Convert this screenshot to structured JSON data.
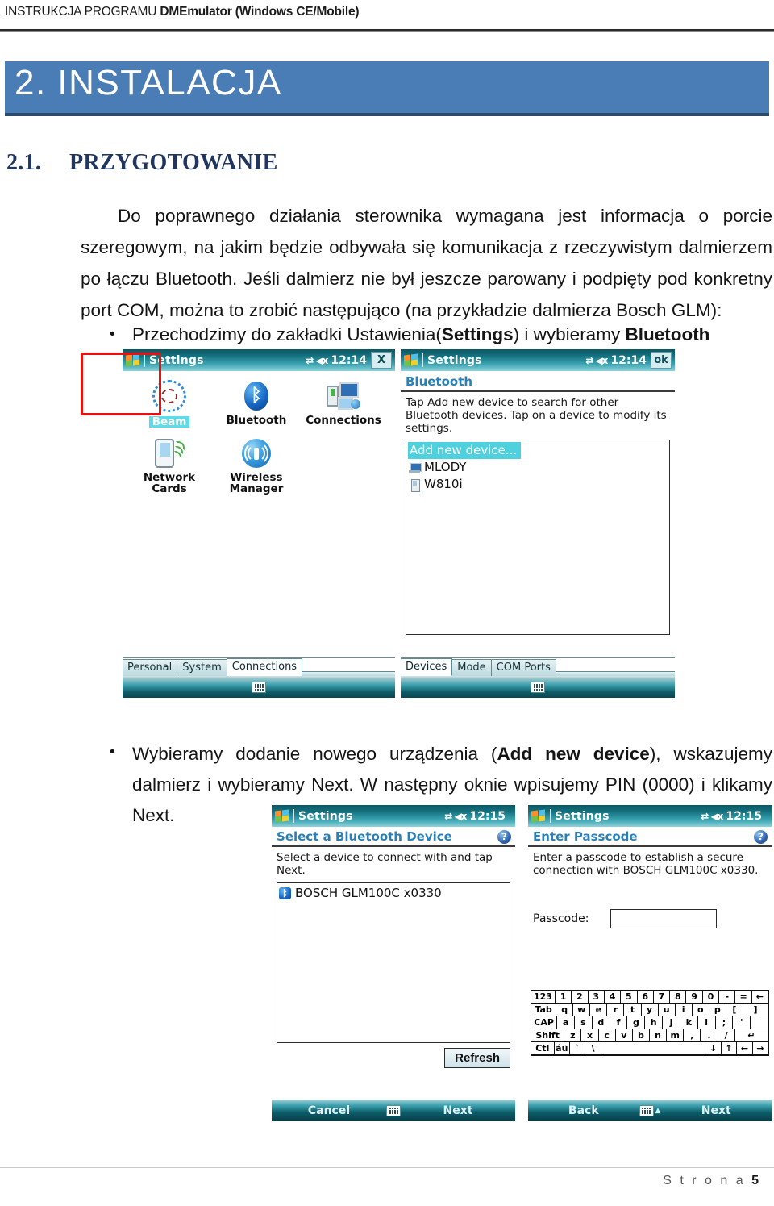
{
  "header": {
    "prefix": "INSTRUKCJA PROGRAMU",
    "title": "DMEmulator (Windows CE/Mobile)"
  },
  "section": {
    "banner_label": "2.  INSTALACJA",
    "sub_number": "2.1.",
    "sub_title": "PRZYGOTOWANIE"
  },
  "body": {
    "paragraph": "Do poprawnego działania sterownika wymagana jest informacja o porcie szeregowym, na jakim będzie odbywała się komunikacja z rzeczywistym dalmierzem po łączu Bluetooth. Jeśli dalmierz nie był jeszcze parowany i podpięty pod konkretny port COM, można to zrobić następująco (na przykładzie dalmierza Bosch GLM):",
    "bullet1_pre": "Przechodzimy do zakładki Ustawienia(",
    "bullet1_b1": "Settings",
    "bullet1_mid": ") i wybieramy ",
    "bullet1_b2": "Bluetooth",
    "bullet2_pre": "Wybieramy dodanie nowego urządzenia (",
    "bullet2_b1": "Add new device",
    "bullet2_post": "), wskazujemy dalmierz i wybieramy Next. W następny oknie wpisujemy PIN (0000) i klikamy Next.",
    "bullet_dot": "•"
  },
  "screen_settings": {
    "titlebar": {
      "title": "Settings",
      "clock": "12:14",
      "corner": "X",
      "sysicons": "⇄ ◀x"
    },
    "icons": [
      {
        "label": "Beam",
        "icon": "beam-icon"
      },
      {
        "label": "Bluetooth",
        "icon": "bluetooth-icon"
      },
      {
        "label": "Connections",
        "icon": "connections-icon"
      },
      {
        "label": "Network Cards",
        "icon": "network-cards-icon"
      },
      {
        "label": "Wireless Manager",
        "icon": "wireless-manager-icon"
      }
    ],
    "tabs": [
      {
        "label": "Personal",
        "active": false
      },
      {
        "label": "System",
        "active": false
      },
      {
        "label": "Connections",
        "active": true
      }
    ]
  },
  "screen_bluetooth": {
    "titlebar": {
      "title": "Settings",
      "clock": "12:14",
      "corner": "ok"
    },
    "page_title": "Bluetooth",
    "help_text": "Tap Add new device to search for other Bluetooth devices. Tap on a device to modify its settings.",
    "devices": [
      {
        "label": "Add new device...",
        "selected": true
      },
      {
        "label": "MLODY",
        "icon": "pc-icon"
      },
      {
        "label": "W810i",
        "icon": "phone-icon"
      }
    ],
    "tabs": [
      {
        "label": "Devices",
        "active": true
      },
      {
        "label": "Mode",
        "active": false
      },
      {
        "label": "COM Ports",
        "active": false
      }
    ]
  },
  "screen_select_device": {
    "titlebar": {
      "title": "Settings",
      "clock": "12:15"
    },
    "page_title": "Select a Bluetooth Device",
    "help_text": "Select a device to connect with and tap Next.",
    "devices": [
      {
        "label": "BOSCH GLM100C x0330"
      }
    ],
    "refresh_label": "Refresh",
    "softkey_left": "Cancel",
    "softkey_right": "Next"
  },
  "screen_passcode": {
    "titlebar": {
      "title": "Settings",
      "clock": "12:15"
    },
    "page_title": "Enter Passcode",
    "help_text": "Enter a passcode to establish a secure connection with BOSCH GLM100C x0330.",
    "field_label": "Passcode:",
    "field_value": "",
    "softkey_left": "Back",
    "softkey_right": "Next",
    "keyboard": [
      [
        "123",
        "1",
        "2",
        "3",
        "4",
        "5",
        "6",
        "7",
        "8",
        "9",
        "0",
        "-",
        "=",
        "←"
      ],
      [
        "Tab",
        "q",
        "w",
        "e",
        "r",
        "t",
        "y",
        "u",
        "i",
        "o",
        "p",
        "[",
        "]"
      ],
      [
        "CAP",
        "a",
        "s",
        "d",
        "f",
        "g",
        "h",
        "j",
        "k",
        "l",
        ";",
        "'"
      ],
      [
        "Shift",
        "z",
        "x",
        "c",
        "v",
        "b",
        "n",
        "m",
        ",",
        ".",
        "/",
        "↵"
      ],
      [
        "Ctl",
        "áü",
        "`",
        "\\",
        " ",
        "↓",
        "↑",
        "←",
        "→"
      ]
    ]
  },
  "footer": {
    "page_label": "S t r o n a",
    "page_number": "5"
  },
  "colors": {
    "banner": "#4a7cb5",
    "heading": "#21365e",
    "selection_red": "#e61212",
    "pda_accent": "#2b7fb5"
  }
}
